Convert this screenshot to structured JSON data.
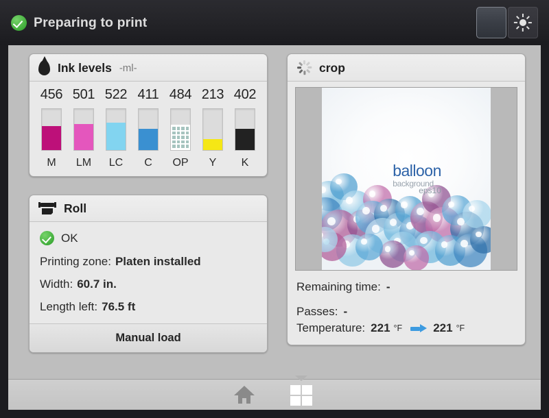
{
  "header": {
    "status_icon": "check-circle-icon",
    "status_title": "Preparing to print",
    "buttons": [
      {
        "name": "blank-button",
        "label": ""
      },
      {
        "name": "brightness-button",
        "icon": "sun-icon"
      }
    ]
  },
  "ink_panel": {
    "icon": "ink-droplet-icon",
    "title": "Ink levels",
    "unit_label": "-ml-",
    "cartridges": [
      {
        "label": "M",
        "value": "456",
        "color": "#bd1079",
        "fill_pct": 58,
        "pattern": false
      },
      {
        "label": "LM",
        "value": "501",
        "color": "#e456bd",
        "fill_pct": 64,
        "pattern": false
      },
      {
        "label": "LC",
        "value": "522",
        "color": "#82d4f0",
        "fill_pct": 67,
        "pattern": false
      },
      {
        "label": "C",
        "value": "411",
        "color": "#3a90d1",
        "fill_pct": 52,
        "pattern": false
      },
      {
        "label": "OP",
        "value": "484",
        "color": "#ffffff",
        "fill_pct": 61,
        "pattern": true
      },
      {
        "label": "Y",
        "value": "213",
        "color": "#f5e715",
        "fill_pct": 27,
        "pattern": false
      },
      {
        "label": "K",
        "value": "402",
        "color": "#222222",
        "fill_pct": 51,
        "pattern": false
      }
    ]
  },
  "roll_panel": {
    "icon": "roll-feed-icon",
    "title": "Roll",
    "status_icon": "check-circle-icon",
    "status_text": "OK",
    "rows": [
      {
        "label": "Printing zone:",
        "value": "Platen installed"
      },
      {
        "label": "Width:",
        "value": "60.7 in."
      },
      {
        "label": "Length left:",
        "value": "76.5 ft"
      }
    ],
    "action_label": "Manual load"
  },
  "job_panel": {
    "icon": "spinner-icon",
    "title": "crop",
    "preview": {
      "title": "balloon",
      "subtitle": "background",
      "eps": "eps10"
    },
    "rows": [
      {
        "label": "Remaining time:",
        "value": "-"
      },
      {
        "label": "Passes:",
        "value": "-"
      }
    ],
    "temperature": {
      "label": "Temperature:",
      "current": "221",
      "current_unit": "°F",
      "arrow_icon": "arrow-right-icon",
      "target": "221",
      "target_unit": "°F"
    }
  },
  "footer": {
    "home_icon": "home-icon",
    "jobs_icon": "window-grid-icon"
  },
  "colors": {
    "accent_blue": "#3d9be0",
    "status_green": "#41ad3b",
    "body_bg": "#bebebe",
    "panel_bg": "#e9e9e9",
    "header_bg": "#232327"
  }
}
